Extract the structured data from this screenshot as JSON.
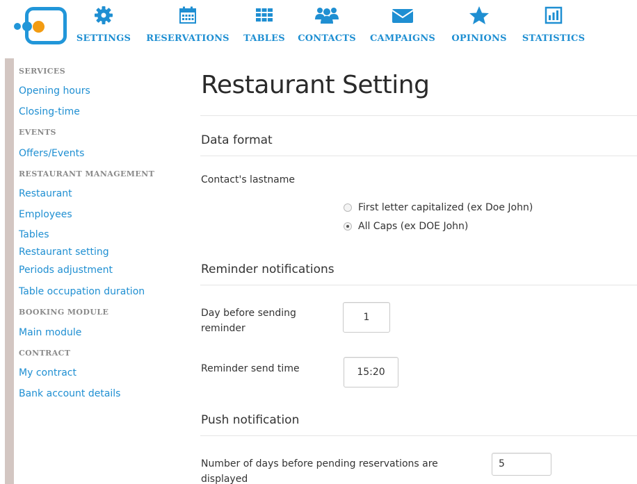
{
  "nav": {
    "items": [
      {
        "label": "SETTINGS",
        "icon": "gear-icon"
      },
      {
        "label": "RESERVATIONS",
        "icon": "calendar-icon"
      },
      {
        "label": "TABLES",
        "icon": "grid-icon"
      },
      {
        "label": "CONTACTS",
        "icon": "users-icon"
      },
      {
        "label": "CAMPAIGNS",
        "icon": "envelope-icon"
      },
      {
        "label": "OPINIONS",
        "icon": "star-icon"
      },
      {
        "label": "STATISTICS",
        "icon": "bar-chart-icon"
      }
    ],
    "color": "#1f8fd2"
  },
  "sidebar": {
    "sections": [
      {
        "heading": "SERVICES",
        "links": [
          "Opening hours",
          "Closing-time"
        ]
      },
      {
        "heading": "EVENTS",
        "links": [
          "Offers/Events"
        ]
      },
      {
        "heading": "RESTAURANT MANAGEMENT",
        "links": [
          "Restaurant",
          "Employees",
          "Tables",
          "Restaurant setting",
          "Periods adjustment",
          "Table occupation duration"
        ]
      },
      {
        "heading": "BOOKING MODULE",
        "links": [
          "Main module"
        ]
      },
      {
        "heading": "CONTRACT",
        "links": [
          "My contract",
          "Bank account details"
        ]
      }
    ]
  },
  "main": {
    "title": "Restaurant Setting",
    "data_format": {
      "title": "Data format",
      "field_label": "Contact's lastname",
      "options": [
        {
          "label": "First letter capitalized (ex Doe John)",
          "checked": false
        },
        {
          "label": "All Caps (ex DOE John)",
          "checked": true
        }
      ]
    },
    "reminder": {
      "title": "Reminder notifications",
      "day_before_label": "Day before sending reminder",
      "day_before_value": "1",
      "send_time_label": "Reminder send time",
      "send_time_value": "15:20"
    },
    "push": {
      "title": "Push notification",
      "days_label": "Number of days before pending reservations are displayed",
      "days_value": "5"
    }
  }
}
